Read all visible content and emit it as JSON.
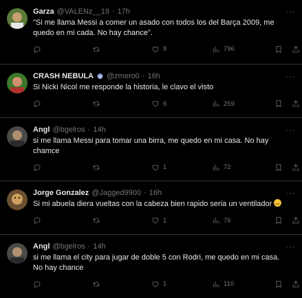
{
  "tweets": [
    {
      "name": "Garza",
      "handle": "@VALENz__19",
      "time": "17h",
      "text": "\"Si me llama Messi a comer un asado con todos los del Barça 2009, me quedo en mi cada. No hay chance\".",
      "replies": "",
      "retweets": "",
      "likes": "8",
      "views": "796",
      "verified": false,
      "avatar_colors": [
        "#5a7a3a",
        "#c8a070"
      ]
    },
    {
      "name": "CRASH NEBULA",
      "handle": "@zmero0",
      "time": "16h",
      "text": "Si Nicki Nicol me responde la historia, le clavo el visto",
      "replies": "",
      "retweets": "",
      "likes": "6",
      "views": "259",
      "verified": true,
      "avatar_colors": [
        "#b03030",
        "#3a7a2a"
      ]
    },
    {
      "name": "Angl",
      "handle": "@bgelros",
      "time": "14h",
      "text": "si me llama Messi para tomar una birra, me quedo en mi casa. No hay chamce",
      "replies": "",
      "retweets": "",
      "likes": "1",
      "views": "72",
      "verified": false,
      "avatar_colors": [
        "#4a4a48",
        "#b09070"
      ]
    },
    {
      "name": "Jorge Gonzalez",
      "handle": "@Jagged9900",
      "time": "16h",
      "text": "Si mi abuela diera vueltas con la cabeza bien rapido seria un ventilador",
      "has_emoji": true,
      "emoji": "laughing-face",
      "replies": "",
      "retweets": "",
      "likes": "1",
      "views": "76",
      "verified": false,
      "avatar_colors": [
        "#6a5030",
        "#d0a060"
      ]
    },
    {
      "name": "Angl",
      "handle": "@bgelros",
      "time": "14h",
      "text": "si me llama el city para jugar de doble 5 con Rodri, me quedo en mi casa. No hay chance",
      "replies": "",
      "retweets": "",
      "likes": "1",
      "views": "110",
      "verified": false,
      "avatar_colors": [
        "#4a4a48",
        "#b09070"
      ]
    }
  ],
  "separator": "·"
}
